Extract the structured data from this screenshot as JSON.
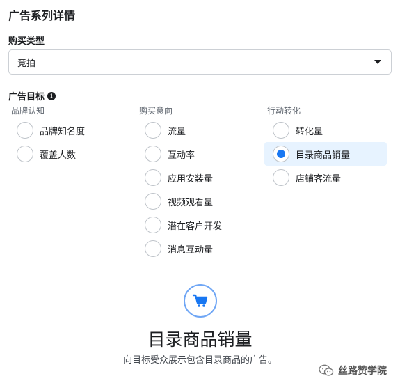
{
  "section_title": "广告系列详情",
  "buy_type": {
    "label": "购买类型",
    "selected": "竞拍"
  },
  "objective": {
    "label": "广告目标",
    "info_icon": "info-icon",
    "columns": [
      {
        "header": "品牌认知",
        "options": [
          {
            "label": "品牌知名度",
            "selected": false
          },
          {
            "label": "覆盖人数",
            "selected": false
          }
        ]
      },
      {
        "header": "购买意向",
        "options": [
          {
            "label": "流量",
            "selected": false
          },
          {
            "label": "互动率",
            "selected": false
          },
          {
            "label": "应用安装量",
            "selected": false
          },
          {
            "label": "视频观看量",
            "selected": false
          },
          {
            "label": "潜在客户开发",
            "selected": false
          },
          {
            "label": "消息互动量",
            "selected": false
          }
        ]
      },
      {
        "header": "行动转化",
        "options": [
          {
            "label": "转化量",
            "selected": false
          },
          {
            "label": "目录商品销量",
            "selected": true
          },
          {
            "label": "店铺客流量",
            "selected": false
          }
        ]
      }
    ]
  },
  "summary": {
    "icon": "shopping-cart-icon",
    "title": "目录商品销量",
    "description": "向目标受众展示包含目录商品的广告。"
  },
  "watermark": {
    "text": "丝路赞学院"
  },
  "colors": {
    "accent": "#1877f2",
    "selected_bg": "#e7f3ff",
    "icon_ring": "#6fa6f5"
  }
}
